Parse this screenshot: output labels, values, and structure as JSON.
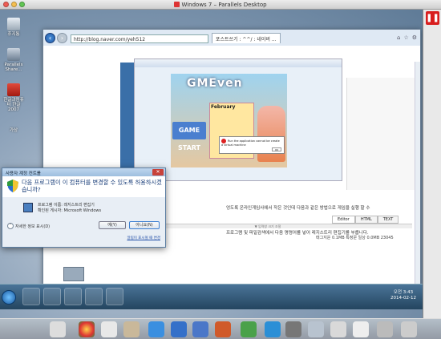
{
  "mac": {
    "title": "Windows 7 – Parallels Desktop"
  },
  "desktop_icons": [
    {
      "label": "휴지통"
    },
    {
      "label": "Parallels Share..."
    },
    {
      "label": "한글과컴퓨터 한글 2007"
    },
    {
      "label": "가상"
    }
  ],
  "ie": {
    "address": "http://blog.naver.com/yeh512",
    "tab_label": "포스트쓰기 : ^^/ : 네이버 ...",
    "embed_title": "",
    "game_logo": "GMEven",
    "game_start": "GAME START",
    "calendar_title": "February",
    "error_text": "Run the application cannot be create a virtual machine",
    "error_ok": "OK",
    "blog_text_1": "엉도록 온라인게임사에서 작은 것인데 다음과 같은 방법으로 게임을 실행 할 수",
    "blog_text_2": "프로그램 및 파일검색에서 다음 명령어를 넣어 레지스트리 편집기를 부릅니다.",
    "editor_tabs": [
      "Editor",
      "HTML",
      "TEXT"
    ],
    "resize_label": "▼ 입력창 크기 조절",
    "meta_text": "태그지운 0.1MB 특정문  일상 0.0MB  23045",
    "info_line": "사진첨부된 글에서 링크 및 블로그 정보 상단레이아웃 중인 다른 링크 첨부 수도 있습니다."
  },
  "uac": {
    "title": "사용자 계정 컨트롤",
    "heading": "다음 프로그램이 이 컴퓨터를 변경할 수 있도록 허용하시겠습니까?",
    "program_label": "프로그램 이름: 레지스트리 편집기",
    "publisher_label": "확인된 게시자: Microsoft Windows",
    "details_label": "자세한 정보 표시(D)",
    "yes_label": "예(Y)",
    "no_label": "아니요(N)",
    "settings_link": "알림이 표시될 때 변경"
  },
  "taskbar": {
    "time": "오전 3:43",
    "date": "2014-02-12"
  }
}
